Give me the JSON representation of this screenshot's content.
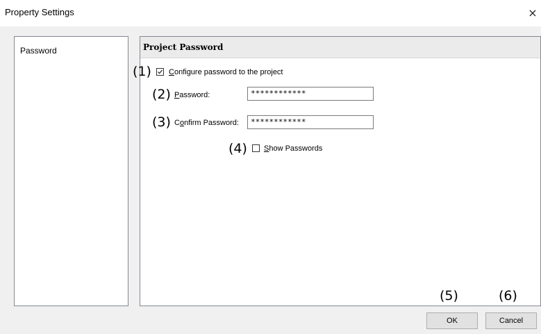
{
  "window": {
    "title": "Property Settings",
    "close_glyph": "×"
  },
  "sidebar": {
    "items": [
      {
        "label": "Password"
      }
    ]
  },
  "panel": {
    "header": "Project Password"
  },
  "form": {
    "configure": {
      "accel": "C",
      "rest": "onfigure password to the project",
      "checked": true
    },
    "password": {
      "pre": "",
      "accel": "P",
      "rest": "assword:",
      "value": "************"
    },
    "confirm": {
      "pre": "C",
      "accel": "o",
      "rest": "nfirm Password:",
      "value": "************"
    },
    "show": {
      "accel": "S",
      "rest": "how Passwords",
      "checked": false
    }
  },
  "buttons": {
    "ok": "OK",
    "cancel": "Cancel"
  },
  "callouts": [
    "(1)",
    "(2)",
    "(3)",
    "(4)",
    "(5)",
    "(6)"
  ],
  "icons": {
    "close": "close-icon",
    "check": "checkmark-icon"
  }
}
